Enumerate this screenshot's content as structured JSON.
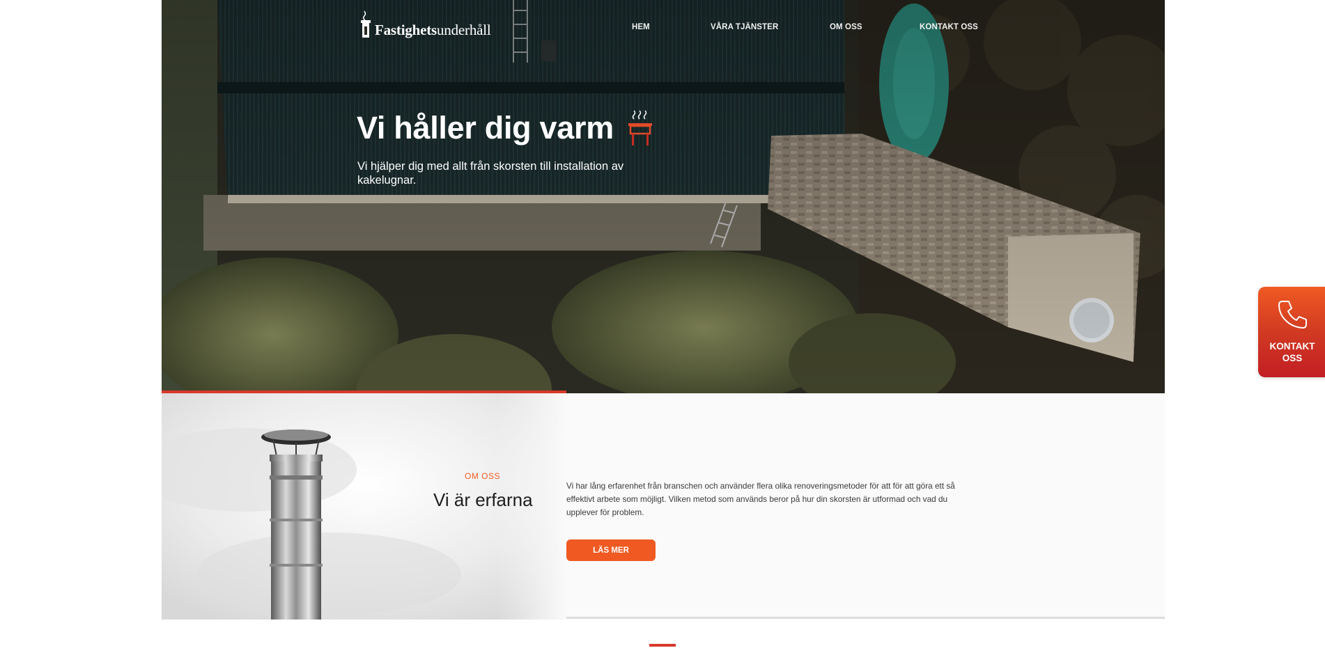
{
  "header": {
    "logo": {
      "bold": "Fastighets",
      "light": "underhåll"
    },
    "nav": [
      {
        "label": "HEM"
      },
      {
        "label": "VÅRA TJÄNSTER"
      },
      {
        "label": "OM OSS"
      },
      {
        "label": "KONTAKT OSS"
      }
    ]
  },
  "hero": {
    "title": "Vi håller dig varm",
    "subtitle": "Vi hjälper dig med allt från skorsten till installation av kakelugnar."
  },
  "about": {
    "kicker": "OM OSS",
    "title": "Vi är erfarna",
    "text": "Vi har lång erfarenhet från branschen och använder flera olika renoveringsmetoder för att för att göra ett så effektivt arbete som möjligt. Vilken metod som används beror på hur din skorsten är utformad och vad du upplever för problem.",
    "button": "LÄS MER"
  },
  "float_contact": {
    "label": "KONTAKT\nOSS"
  },
  "colors": {
    "accent": "#f05a22",
    "red": "#d8392b",
    "dark": "#1e1e1e"
  },
  "icons": {
    "phone": "phone-icon",
    "fire": "fire-icon",
    "logo": "logo-mark"
  }
}
